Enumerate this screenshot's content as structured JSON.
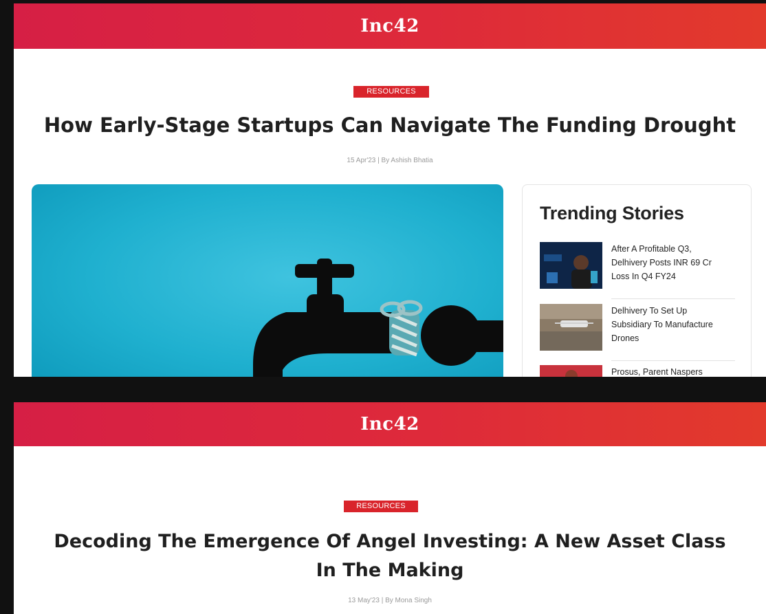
{
  "brand": {
    "name": "Inc42",
    "accent": "#d9242b"
  },
  "article_top": {
    "category": "RESOURCES",
    "title": "How Early-Stage Startups Can Navigate The Funding Drought",
    "meta": "15 Apr'23 | By Ashish Bhatia",
    "hero_icon": "water-tap-icon"
  },
  "trending": {
    "heading": "Trending Stories",
    "stories": [
      {
        "headline": "After A Profitable Q3, Delhivery Posts INR 69 Cr Loss In Q4 FY24"
      },
      {
        "headline": "Delhivery To Set Up Subsidiary To Manufacture Drones"
      },
      {
        "headline": "Prosus, Parent Naspers"
      }
    ]
  },
  "article_bottom": {
    "category": "RESOURCES",
    "title_line1": "Decoding The Emergence Of Angel Investing: A New Asset Class",
    "title_line2": "In The Making",
    "meta": "13 May'23 | By Mona Singh"
  }
}
